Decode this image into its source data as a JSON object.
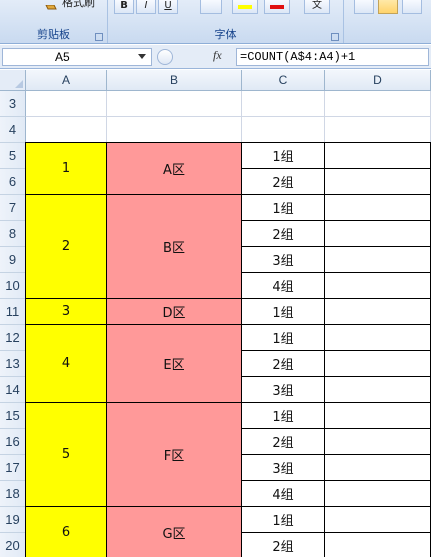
{
  "ribbon": {
    "clipboard_label": "剪贴板",
    "font_label": "字体",
    "format_painter_partial": "格式刷",
    "bold": "B",
    "italic": "I",
    "underline": "U",
    "wen": "文"
  },
  "formula_bar": {
    "name_box": "A5",
    "fx_label": "fx",
    "formula": "=COUNT(A$4:A4)+1"
  },
  "columns": [
    "A",
    "B",
    "C",
    "D"
  ],
  "rows": [
    "3",
    "4",
    "5",
    "6",
    "7",
    "8",
    "9",
    "10",
    "11",
    "12",
    "13",
    "14",
    "15",
    "16",
    "17",
    "18",
    "19",
    "20"
  ],
  "groups": [
    {
      "number": "1",
      "area": "A区",
      "first_row": 5,
      "span": 2,
      "subgroups": [
        "1组",
        "2组"
      ]
    },
    {
      "number": "2",
      "area": "B区",
      "first_row": 7,
      "span": 4,
      "subgroups": [
        "1组",
        "2组",
        "3组",
        "4组"
      ]
    },
    {
      "number": "3",
      "area": "D区",
      "first_row": 11,
      "span": 1,
      "subgroups": [
        "1组"
      ]
    },
    {
      "number": "4",
      "area": "E区",
      "first_row": 12,
      "span": 3,
      "subgroups": [
        "1组",
        "2组",
        "3组"
      ]
    },
    {
      "number": "5",
      "area": "F区",
      "first_row": 15,
      "span": 4,
      "subgroups": [
        "1组",
        "2组",
        "3组",
        "4组"
      ]
    },
    {
      "number": "6",
      "area": "G区",
      "first_row": 19,
      "span": 2,
      "subgroups": [
        "1组",
        "2组"
      ]
    }
  ],
  "colors": {
    "number_fill": "#ffff00",
    "area_fill": "#ff9999",
    "grid_line": "#d0d7e5",
    "header_bg": "#e4ecf7"
  }
}
